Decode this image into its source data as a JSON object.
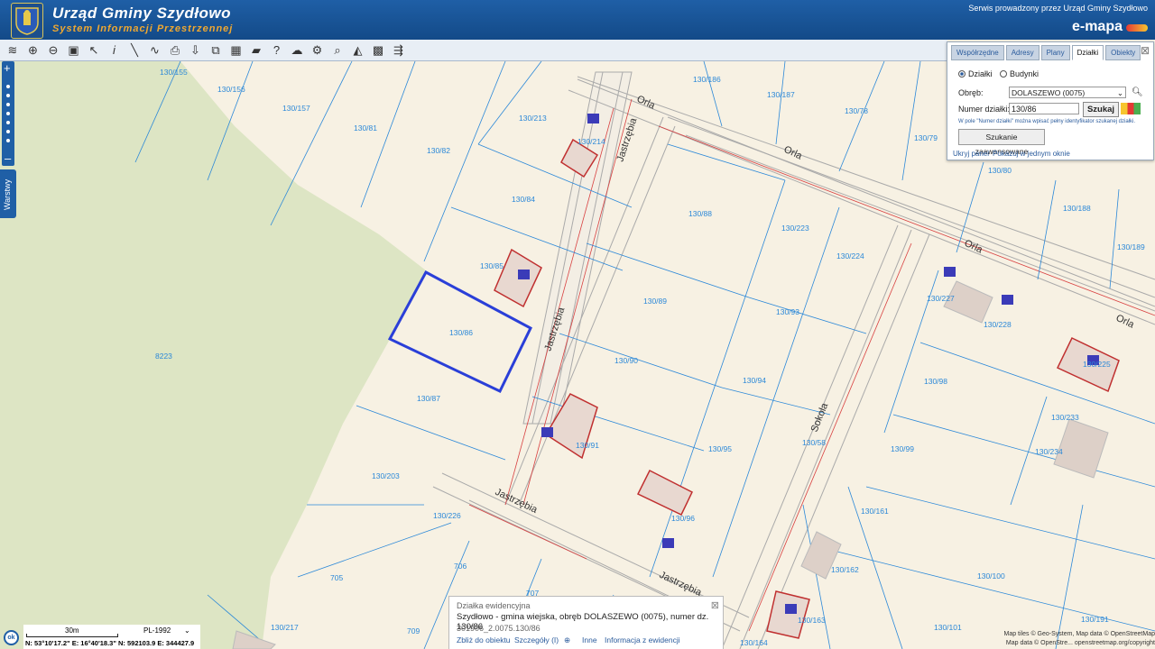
{
  "header": {
    "title": "Urząd Gminy Szydłowo",
    "subtitle": "System Informacji Przestrzennej",
    "service": "Serwis prowadzony przez Urząd Gminy Szydłowo",
    "brand": "e-mapa"
  },
  "toolbar": {
    "icons": [
      "layers-icon",
      "zoom-in-icon",
      "zoom-out-icon",
      "zoom-extent-icon",
      "select-icon",
      "info-icon",
      "measure-line-icon",
      "measure-area-icon",
      "print-icon",
      "download-icon",
      "layout-icon",
      "table-icon",
      "comment-icon",
      "help-icon",
      "upload-icon",
      "settings-icon",
      "find-icon",
      "triangle-icon",
      "tiles-icon",
      "share-icon"
    ]
  },
  "sidebar": {
    "layers_label": "Warstwy"
  },
  "panel": {
    "tabs": [
      "Współrzędne",
      "Adresy",
      "Plany",
      "Działki",
      "Obiekty"
    ],
    "active_tab": "Działki",
    "radio_dzialki": "Działki",
    "radio_budynki": "Budynki",
    "obreb_label": "Obręb:",
    "obreb_value": "DOLASZEWO (0075)",
    "numer_label": "Numer działki:",
    "numer_value": "130/86",
    "search_button": "Szukaj",
    "hint": "W pole \"Numer działki\" można wpisać pełny identyfikator szukanej działki.",
    "advanced_button": "Szukanie zaawansowane",
    "hide_panel": "Ukryj panel",
    "show_window": "Pokazuj w jednym oknie"
  },
  "popup": {
    "title": "Działka ewidencyjna",
    "line": "Szydłowo - gmina wiejska, obręb DOLASZEWO (0075), numer dz. 130/86",
    "gmina": "Szydłowo",
    "gmina_type": "gmina wiejska",
    "obreb": "DOLASZEWO (0075)",
    "numer": "130/86",
    "id": "301906_2.0075.130/86",
    "links": [
      "Zbliż do obiektu",
      "Szczegóły (I)",
      "Inne",
      "Informacja z ewidencji"
    ]
  },
  "scale": {
    "label": "30m",
    "crs": "PL-1992",
    "coords": "N: 53°10'17.2\"  E: 16°40'18.3\"  N: 592103.9  E: 344427.9"
  },
  "attribution": {
    "line1": "Map tiles © Geo-System, Map data © OpenStreetMap",
    "line2": "Map data © OpenStre... openstreetmap.org/copyright"
  },
  "map": {
    "parcel_labels": [
      "130/155",
      "130/156",
      "130/157",
      "130/81",
      "130/82",
      "130/84",
      "130/85",
      "130/86",
      "130/87",
      "8223",
      "130/203",
      "130/226",
      "705",
      "706",
      "707",
      "709",
      "130/217",
      "130/213",
      "130/214",
      "130/186",
      "130/187",
      "130/78",
      "130/79",
      "130/80",
      "130/188",
      "130/189",
      "130/88",
      "130/89",
      "130/90",
      "130/91",
      "130/93",
      "130/94",
      "130/95",
      "130/96",
      "130/98",
      "130/99",
      "130/223",
      "130/224",
      "130/227",
      "130/228",
      "130/225",
      "130/233",
      "130/234",
      "130/58",
      "130/161",
      "130/162",
      "130/163",
      "130/164",
      "130/100",
      "130/101",
      "130/191"
    ],
    "street_labels": [
      "Orla",
      "Jastrzębia",
      "Sokola"
    ],
    "highlighted_parcel": "130/86"
  }
}
